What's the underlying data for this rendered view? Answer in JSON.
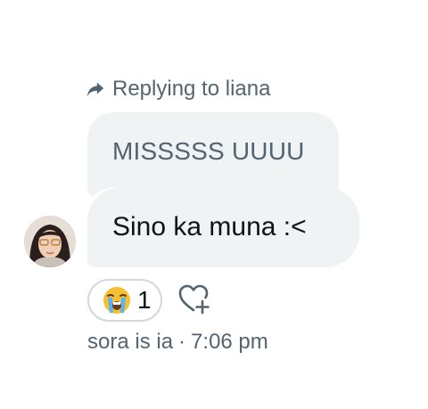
{
  "reply": {
    "icon": "reply-arrow-icon",
    "text": "Replying to liana"
  },
  "quoted_message": {
    "text": "MISSSSS UUUU"
  },
  "message": {
    "text": "Sino ka muna :<"
  },
  "reaction": {
    "emoji": "loudly-crying-face",
    "count": "1"
  },
  "add_reaction": {
    "icon": "heart-plus-icon"
  },
  "meta": {
    "sender": "sora is ia",
    "separator": "·",
    "time": "7:06 pm"
  },
  "colors": {
    "bubble_bg": "#eff3f4",
    "secondary_text": "#536471",
    "primary_text": "#0f1419",
    "border": "#cfd9de"
  }
}
